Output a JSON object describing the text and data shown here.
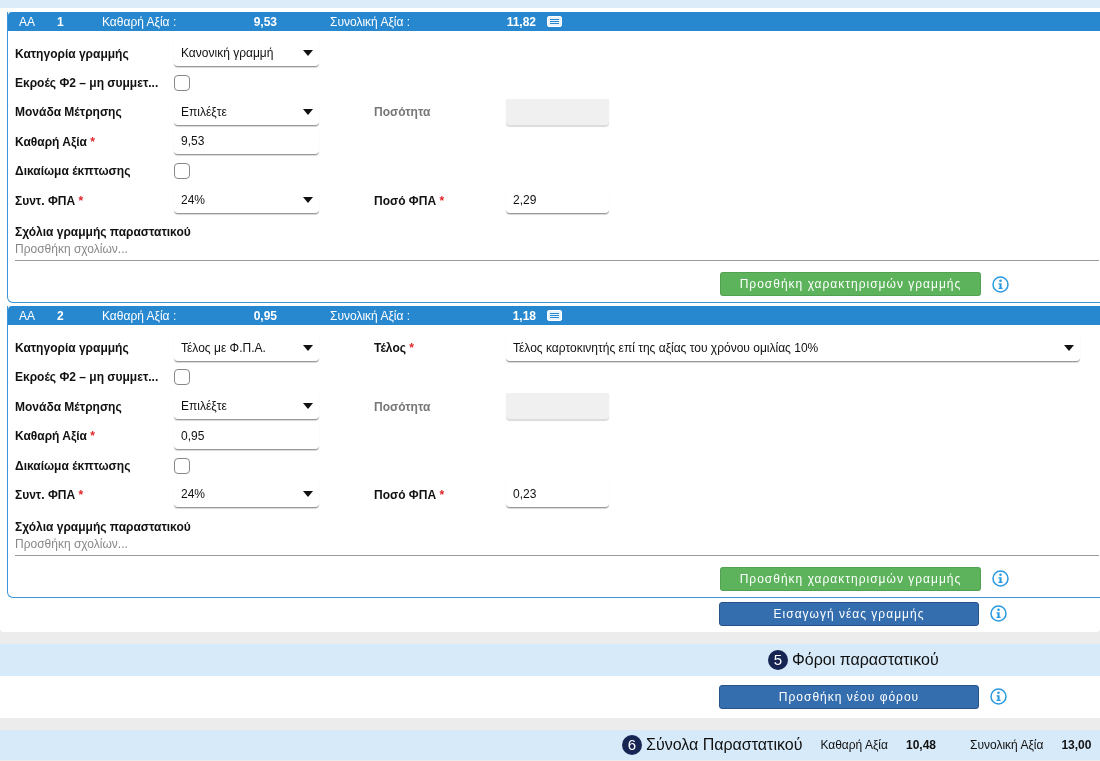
{
  "lines": [
    {
      "header": {
        "prefix": "AA",
        "number": "1",
        "net_label": "Καθαρή Αξία :",
        "net_value": "9,53",
        "total_label": "Συνολική Αξία :",
        "total_value": "11,82"
      },
      "rows": [
        {
          "label": "Κατηγορία γραμμής",
          "required": false,
          "kind": "select",
          "value": "Κανονική γραμμή"
        },
        {
          "label": "Εκροές Φ2 – μη συμμετ...",
          "required": false,
          "kind": "checkbox",
          "checked": false
        },
        {
          "label": "Μονάδα Μέτρησης",
          "required": false,
          "kind": "select",
          "value": "Επιλέξτε",
          "side": {
            "label": "Ποσότητα",
            "required": false,
            "kind": "input",
            "disabled": true,
            "wide": false
          }
        },
        {
          "label": "Καθαρή Αξία",
          "required": true,
          "kind": "input",
          "value": "9,53"
        },
        {
          "label": "Δικαίωμα έκπτωσης",
          "required": false,
          "kind": "checkbox",
          "checked": false
        },
        {
          "label": "Συντ. ΦΠΑ",
          "required": true,
          "kind": "select",
          "value": "24%",
          "side": {
            "label": "Ποσό ΦΠΑ",
            "required": true,
            "kind": "input",
            "value": "2,29",
            "disabled": false,
            "wide": false
          }
        }
      ],
      "comments": {
        "label": "Σχόλια γραμμής παραστατικού",
        "placeholder": "Προσθήκη σχολίων..."
      },
      "button": "Προσθήκη χαρακτηρισμών γραμμής"
    },
    {
      "header": {
        "prefix": "AA",
        "number": "2",
        "net_label": "Καθαρή Αξία :",
        "net_value": "0,95",
        "total_label": "Συνολική Αξία :",
        "total_value": "1,18"
      },
      "rows": [
        {
          "label": "Κατηγορία γραμμής",
          "required": false,
          "kind": "select",
          "value": "Τέλος με Φ.Π.Α.",
          "side": {
            "label": "Τέλος",
            "required": true,
            "kind": "select",
            "value": "Τέλος καρτοκινητής επί της αξίας του χρόνου ομιλίας 10%",
            "disabled": false,
            "wide": true
          }
        },
        {
          "label": "Εκροές Φ2 – μη συμμετ...",
          "required": false,
          "kind": "checkbox",
          "checked": false
        },
        {
          "label": "Μονάδα Μέτρησης",
          "required": false,
          "kind": "select",
          "value": "Επιλέξτε",
          "side": {
            "label": "Ποσότητα",
            "required": false,
            "kind": "input",
            "disabled": true,
            "wide": false
          }
        },
        {
          "label": "Καθαρή Αξία",
          "required": true,
          "kind": "input",
          "value": "0,95"
        },
        {
          "label": "Δικαίωμα έκπτωσης",
          "required": false,
          "kind": "checkbox",
          "checked": false
        },
        {
          "label": "Συντ. ΦΠΑ",
          "required": true,
          "kind": "select",
          "value": "24%",
          "side": {
            "label": "Ποσό ΦΠΑ",
            "required": true,
            "kind": "input",
            "value": "0,23",
            "disabled": false,
            "wide": false
          }
        }
      ],
      "comments": {
        "label": "Σχόλια γραμμής παραστατικού",
        "placeholder": "Προσθήκη σχολίων..."
      },
      "button": "Προσθήκη χαρακτηρισμών γραμμής"
    }
  ],
  "required_marker": "*",
  "insert_button": "Εισαγωγή νέας γραμμής",
  "taxes": {
    "number": "5",
    "title": "Φόροι παραστατικού",
    "button": "Προσθήκη νέου φόρου"
  },
  "totals": {
    "number": "6",
    "title": "Σύνολα Παραστατικού",
    "net_label": "Καθαρή Αξία",
    "net_value": "10,48",
    "total_label": "Συνολική Αξία",
    "total_value": "13,00"
  }
}
